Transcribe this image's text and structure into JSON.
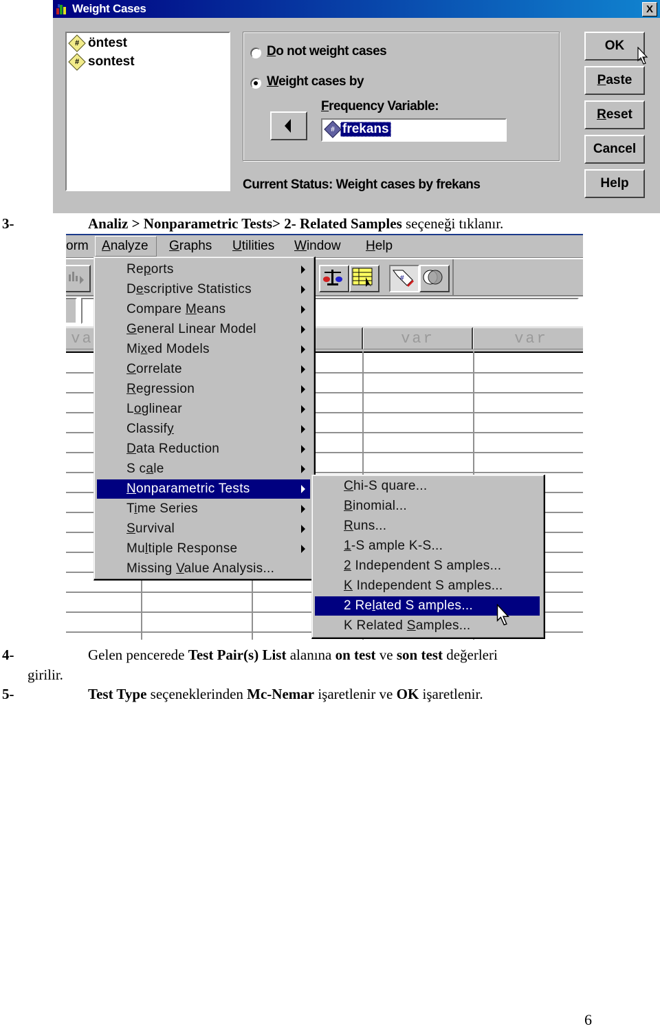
{
  "dialog": {
    "title": "Weight Cases",
    "close_label": "X",
    "variables": [
      {
        "icon": "numeric-variable-icon",
        "name": "öntest"
      },
      {
        "icon": "numeric-variable-icon",
        "name": "sontest"
      }
    ],
    "options": [
      {
        "label": "Do not weight cases",
        "selected": false
      },
      {
        "label": "Weight cases by",
        "selected": true
      }
    ],
    "frequency_label": "Frequency Variable:",
    "frequency_value": "frekans",
    "status": "Current Status: Weight cases by frekans",
    "buttons": [
      "OK",
      "Paste",
      "Reset",
      "Cancel",
      "Help"
    ],
    "num_glyph": "#"
  },
  "steps": {
    "step3": {
      "num": "3-",
      "bold": "Analiz > Nonparametric Tests> 2- Related Samples",
      "rest": " seçeneği tıklanır."
    },
    "step4": {
      "num": "4-",
      "parts": [
        "Gelen pencerede ",
        "Test  Pair(s) List",
        " alanına ",
        "on test",
        " ve ",
        "son test",
        " değerleri"
      ],
      "wrap": "girilir."
    },
    "step5": {
      "num": "5-",
      "parts": [
        "Test Type",
        " seçeneklerinden ",
        "Mc-Nemar",
        " işaretlenir ve ",
        "OK",
        " işaretlenir."
      ]
    }
  },
  "spss": {
    "menubar": [
      "orm",
      "Analyze",
      "Graphs",
      "Utilities",
      "Window",
      "Help"
    ],
    "column_headers": [
      "va",
      "r",
      "var",
      "var"
    ],
    "analyze_menu": [
      {
        "label": "Reports",
        "submenu": true
      },
      {
        "label": "Descriptive Statistics",
        "submenu": true
      },
      {
        "label": "Compare Means",
        "submenu": true
      },
      {
        "label": "General Linear Model",
        "submenu": true
      },
      {
        "label": "Mixed Models",
        "submenu": true
      },
      {
        "label": "Correlate",
        "submenu": true
      },
      {
        "label": "Regression",
        "submenu": true
      },
      {
        "label": "Loglinear",
        "submenu": true
      },
      {
        "label": "Classify",
        "submenu": true
      },
      {
        "label": "Data Reduction",
        "submenu": true
      },
      {
        "label": "Scale",
        "submenu": true
      },
      {
        "label": "Nonparametric Tests",
        "submenu": true,
        "highlighted": true
      },
      {
        "label": "Time Series",
        "submenu": true
      },
      {
        "label": "Survival",
        "submenu": true
      },
      {
        "label": "Multiple Response",
        "submenu": true
      },
      {
        "label": "Missing Value Analysis...",
        "submenu": false
      }
    ],
    "nonparametric_menu": [
      {
        "label": "Chi-Square..."
      },
      {
        "label": "Binomial..."
      },
      {
        "label": "Runs..."
      },
      {
        "label": "1-Sample K-S..."
      },
      {
        "label": "2 Independent Samples..."
      },
      {
        "label": "K Independent Samples..."
      },
      {
        "label": "2 Related Samples...",
        "highlighted": true
      },
      {
        "label": "K Related Samples..."
      }
    ],
    "highlight_color": "#000080"
  },
  "page_number": "6"
}
